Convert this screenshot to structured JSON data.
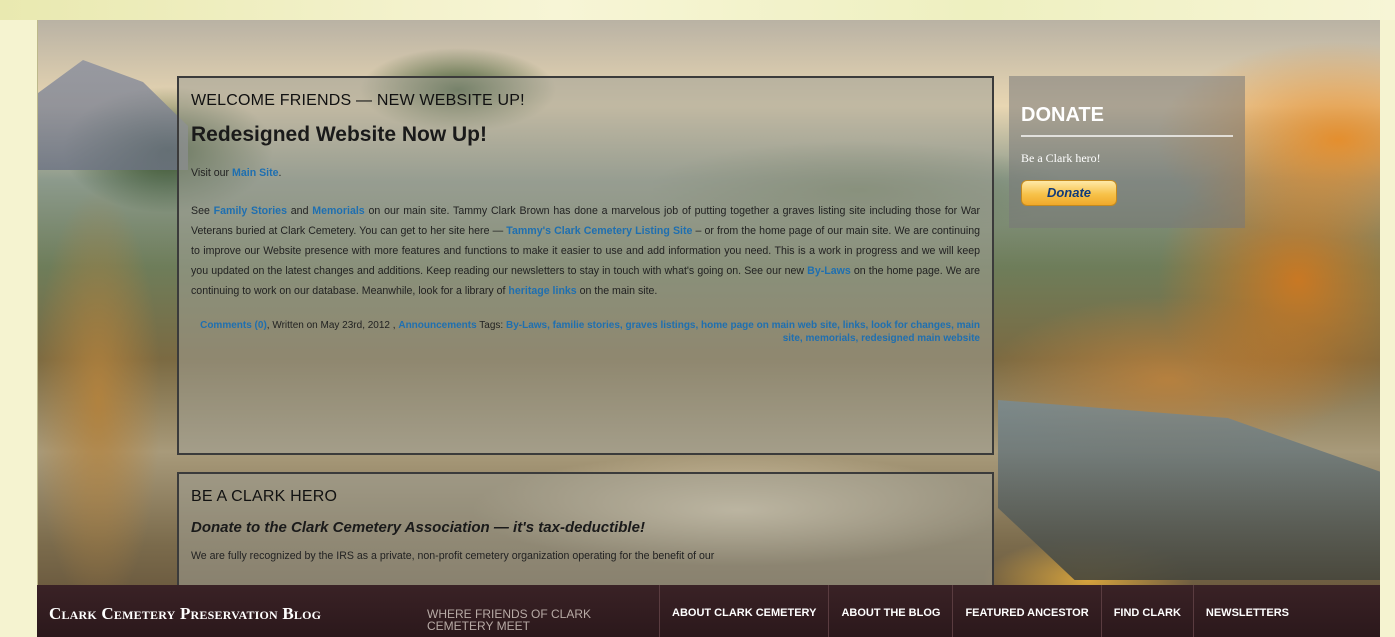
{
  "post1": {
    "kicker": "WELCOME FRIENDS — NEW WEBSITE UP!",
    "title": "Redesigned Website Now Up!",
    "p1_prefix": "Visit our ",
    "p1_link": "Main Site",
    "p1_suffix": ".",
    "p2": {
      "t1": "See ",
      "link_family": "Family Stories",
      "t2": " and ",
      "link_memorials": "Memorials",
      "t3": " on our main site. Tammy Clark Brown has done a marvelous job of putting together a graves listing site including those for War Veterans buried at Clark Cemetery. You can get to her site here — ",
      "link_tammy": "Tammy's Clark Cemetery Listing Site",
      "t4": " – or from the home page of our main site. We are continuing to improve our Website presence with more features and functions to make it easier to use and add information you need. This is a work in progress and we will keep you updated on the latest changes and additions. Keep reading our newsletters to stay in touch with what's going on. See our new ",
      "link_bylaws": "By-Laws",
      "t5": " on the home page. We are continuing to work on our database. Meanwhile, look for a library of ",
      "link_heritage": "heritage links",
      "t6": " on the main site."
    },
    "meta": {
      "comments": "Comments (0)",
      "written": ", Written on May 23rd, 2012 , ",
      "category": "Announcements",
      "tags_label": " Tags: ",
      "tags": "By-Laws, familie stories, graves listings, home page on main web site, links, look for changes, main site, memorials, redesigned main website"
    }
  },
  "post2": {
    "kicker": "BE A CLARK HERO",
    "subtitle": "Donate to the Clark Cemetery Association — it's tax-deductible!",
    "body_cut": "We are fully recognized by the IRS as a private, non-profit cemetery organization operating for the benefit of our"
  },
  "donate": {
    "title": "DONATE",
    "text": "Be a Clark hero!",
    "button": "Donate"
  },
  "navbar": {
    "brand": "Clark Cemetery Preservation Blog",
    "tagline": "Where Friends of Clark Cemetery Meet",
    "items": [
      "About Clark Cemetery",
      "About the Blog",
      "Featured Ancestor",
      "Find Clark",
      "Newsletters"
    ]
  }
}
